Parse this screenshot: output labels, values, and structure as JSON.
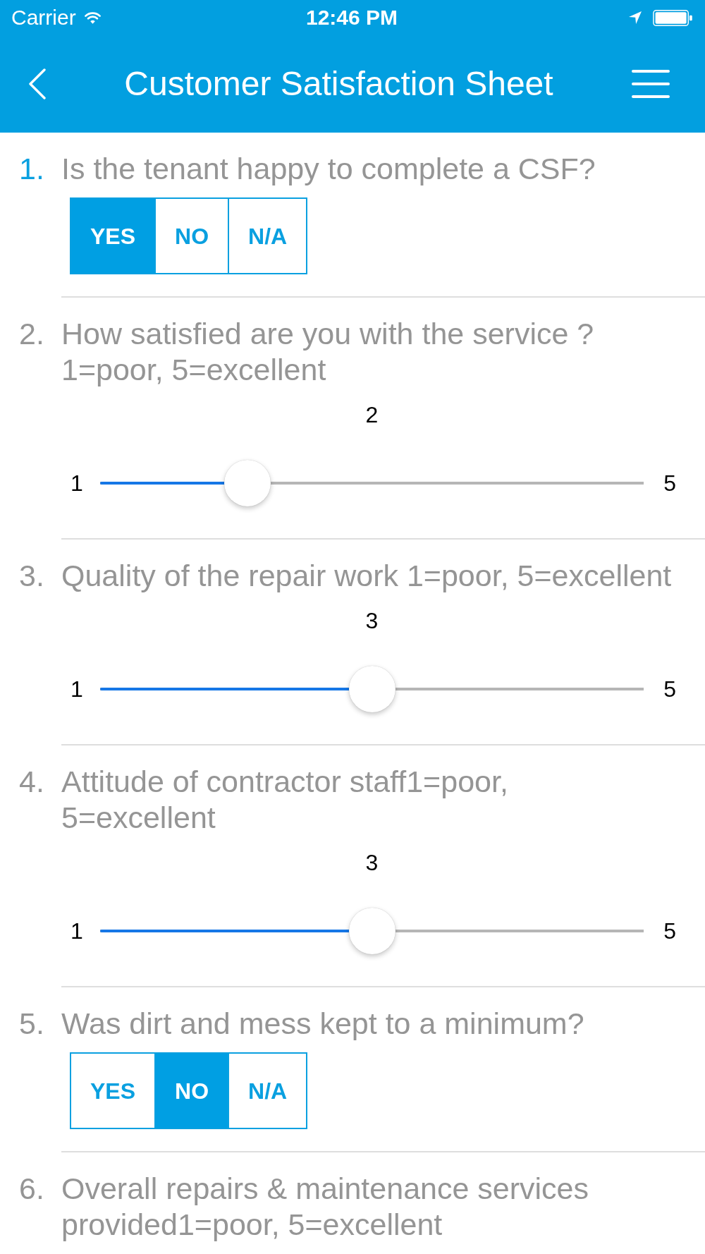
{
  "status_bar": {
    "carrier": "Carrier",
    "time": "12:46 PM"
  },
  "nav_bar": {
    "title": "Customer Satisfaction Sheet"
  },
  "questions": [
    {
      "kind": "choice",
      "number": "1.",
      "current": true,
      "text": "Is the tenant happy to complete a CSF?",
      "options": [
        {
          "label": "YES",
          "selected": true
        },
        {
          "label": "NO",
          "selected": false
        },
        {
          "label": "N/A",
          "selected": false
        }
      ]
    },
    {
      "kind": "rating",
      "number": "2.",
      "current": false,
      "text": "How satisfied are you with the service ?\n1=poor, 5=excellent",
      "value": "2",
      "min_label": "1",
      "max_label": "5",
      "level": 0.25
    },
    {
      "kind": "rating",
      "number": "3.",
      "current": false,
      "text": "Quality of the repair work 1=poor, 5=excellent",
      "value": "3",
      "min_label": "1",
      "max_label": "5",
      "level": 0.5
    },
    {
      "kind": "rating",
      "number": "4.",
      "current": false,
      "text": "Attitude of contractor staff1=poor,\n5=excellent",
      "value": "3",
      "min_label": "1",
      "max_label": "5",
      "level": 0.5
    },
    {
      "kind": "choice",
      "number": "5.",
      "current": false,
      "text": "Was dirt and mess kept to a minimum?",
      "options": [
        {
          "label": "YES",
          "selected": false
        },
        {
          "label": "NO",
          "selected": true
        },
        {
          "label": "N/A",
          "selected": false
        }
      ]
    },
    {
      "kind": "rating",
      "number": "6.",
      "current": false,
      "text": "Overall repairs & maintenance services\nprovided1=poor, 5=excellent"
    }
  ]
}
